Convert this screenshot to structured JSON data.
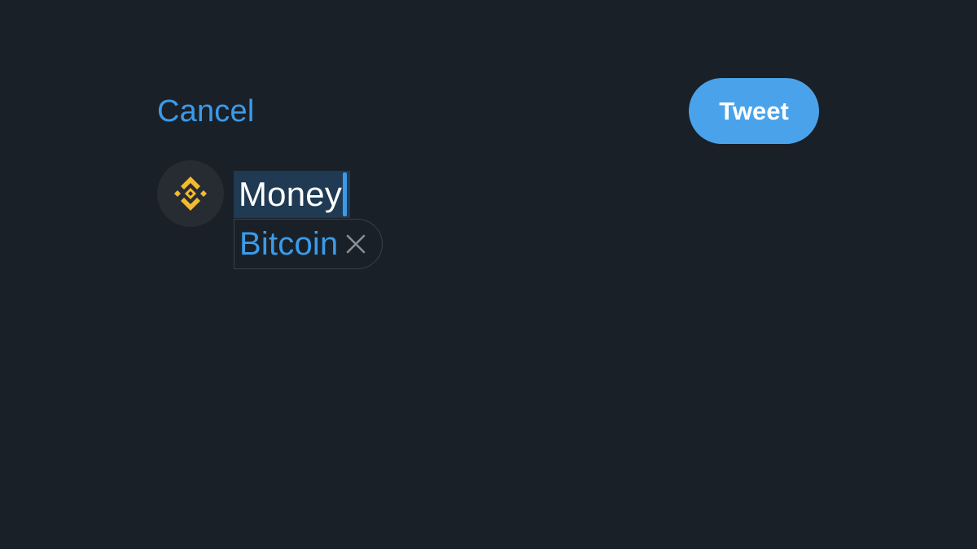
{
  "header": {
    "cancel_label": "Cancel",
    "tweet_label": "Tweet"
  },
  "avatar": {
    "icon": "binance-logo-icon",
    "color": "#F3BA2F"
  },
  "composer": {
    "text": "Money"
  },
  "suggestion": {
    "label": "Bitcoin",
    "dismiss_icon": "close-icon"
  },
  "colors": {
    "background": "#1a2028",
    "accent": "#3b9be8",
    "tweet_button": "#4aa3ea",
    "selection": "#1f3a52"
  }
}
